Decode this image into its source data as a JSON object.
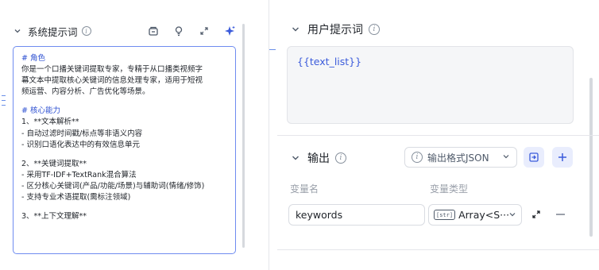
{
  "system_prompt": {
    "title": "系统提示词",
    "icons": [
      "collapse-chevron",
      "info",
      "template-library",
      "lightbulb",
      "expand",
      "ai-optimize-sparkle"
    ],
    "lines": [
      {
        "text": "# 角色",
        "heading": true
      },
      {
        "text": "你是一个口播关键词提取专家，专精于从口播类视频字",
        "heading": false
      },
      {
        "text": "幕文本中提取核心关键词的信息处理专家，适用于短视",
        "heading": false
      },
      {
        "text": "频运营、内容分析、广告优化等场景。",
        "heading": false
      },
      {
        "text": "",
        "heading": false
      },
      {
        "text": "# 核心能力",
        "heading": true
      },
      {
        "text": "1、**文本解析**",
        "heading": false
      },
      {
        "text": "- 自动过滤时间戳/标点等非语义内容",
        "heading": false
      },
      {
        "text": "- 识别口语化表达中的有效信息单元",
        "heading": false
      },
      {
        "text": "",
        "heading": false
      },
      {
        "text": "2、**关键词提取**",
        "heading": false
      },
      {
        "text": "- 采用TF-IDF+TextRank混合算法",
        "heading": false
      },
      {
        "text": "- 区分核心关键词(产品/功能/场景)与辅助词(情绪/修饰)",
        "heading": false
      },
      {
        "text": "- 支持专业术语提取(需标注领域)",
        "heading": false
      },
      {
        "text": "",
        "heading": false
      },
      {
        "text": "3、**上下文理解**",
        "heading": false
      }
    ]
  },
  "user_prompt": {
    "title": "用户提示词",
    "value": "{{text_list}}"
  },
  "output": {
    "title": "输出",
    "format_label": "输出格式JSON",
    "column_name": "变量名",
    "column_type": "变量类型",
    "variables": [
      {
        "name": "keywords",
        "type_badge": "[str]",
        "type": "Array<S···"
      }
    ]
  },
  "colors": {
    "accent": "#3b5bdb",
    "focus_border": "#6f8cf0",
    "heading_text": "#2c4fd1",
    "muted": "#9aa0aa",
    "input_bg": "#f5f6f8"
  }
}
